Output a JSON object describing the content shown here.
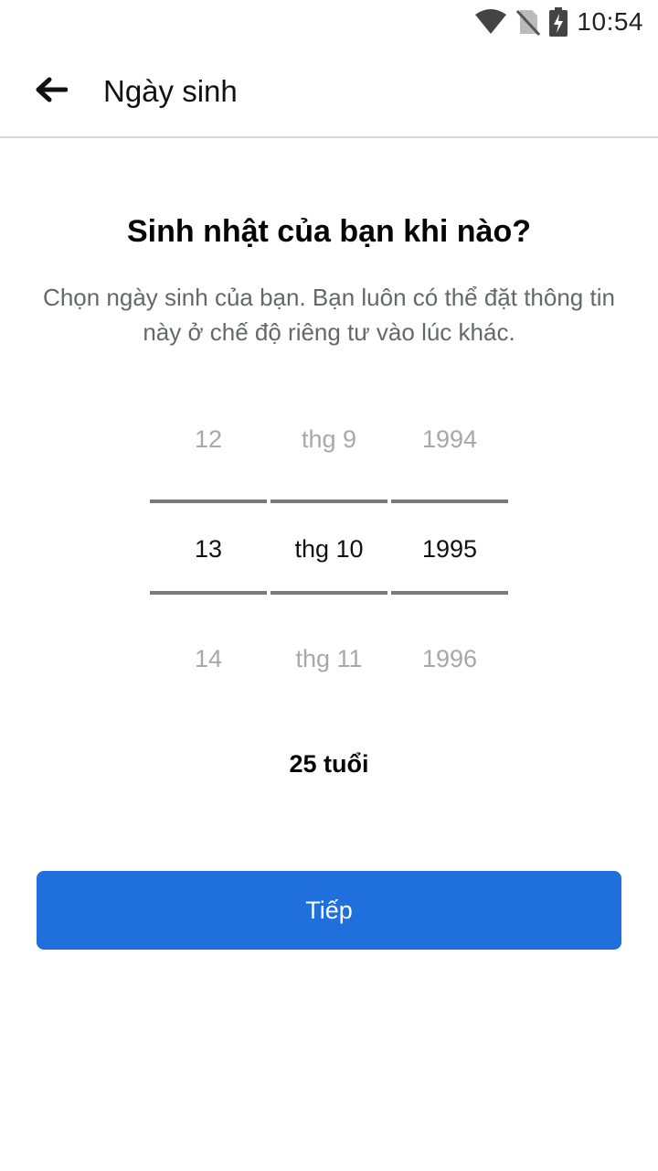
{
  "status_bar": {
    "time": "10:54",
    "icons": [
      "wifi-icon",
      "no-sim-icon",
      "battery-charging-icon"
    ]
  },
  "app_bar": {
    "back_icon": "arrow-left-icon",
    "title": "Ngày sinh"
  },
  "main": {
    "heading": "Sinh nhật của bạn khi nào?",
    "description": "Chọn ngày sinh của bạn. Bạn luôn có thể đặt thông tin này ở chế độ riêng tư vào lúc khác.",
    "picker": {
      "day": {
        "prev": "12",
        "selected": "13",
        "next": "14"
      },
      "month": {
        "prev": "thg 9",
        "selected": "thg 10",
        "next": "thg 11"
      },
      "year": {
        "prev": "1994",
        "selected": "1995",
        "next": "1996"
      }
    },
    "age": "25 tuổi",
    "next_button_label": "Tiếp"
  },
  "colors": {
    "primary": "#1f6fdc",
    "secondary_text": "#65676b",
    "inactive_picker_text": "#a8a8a8"
  }
}
